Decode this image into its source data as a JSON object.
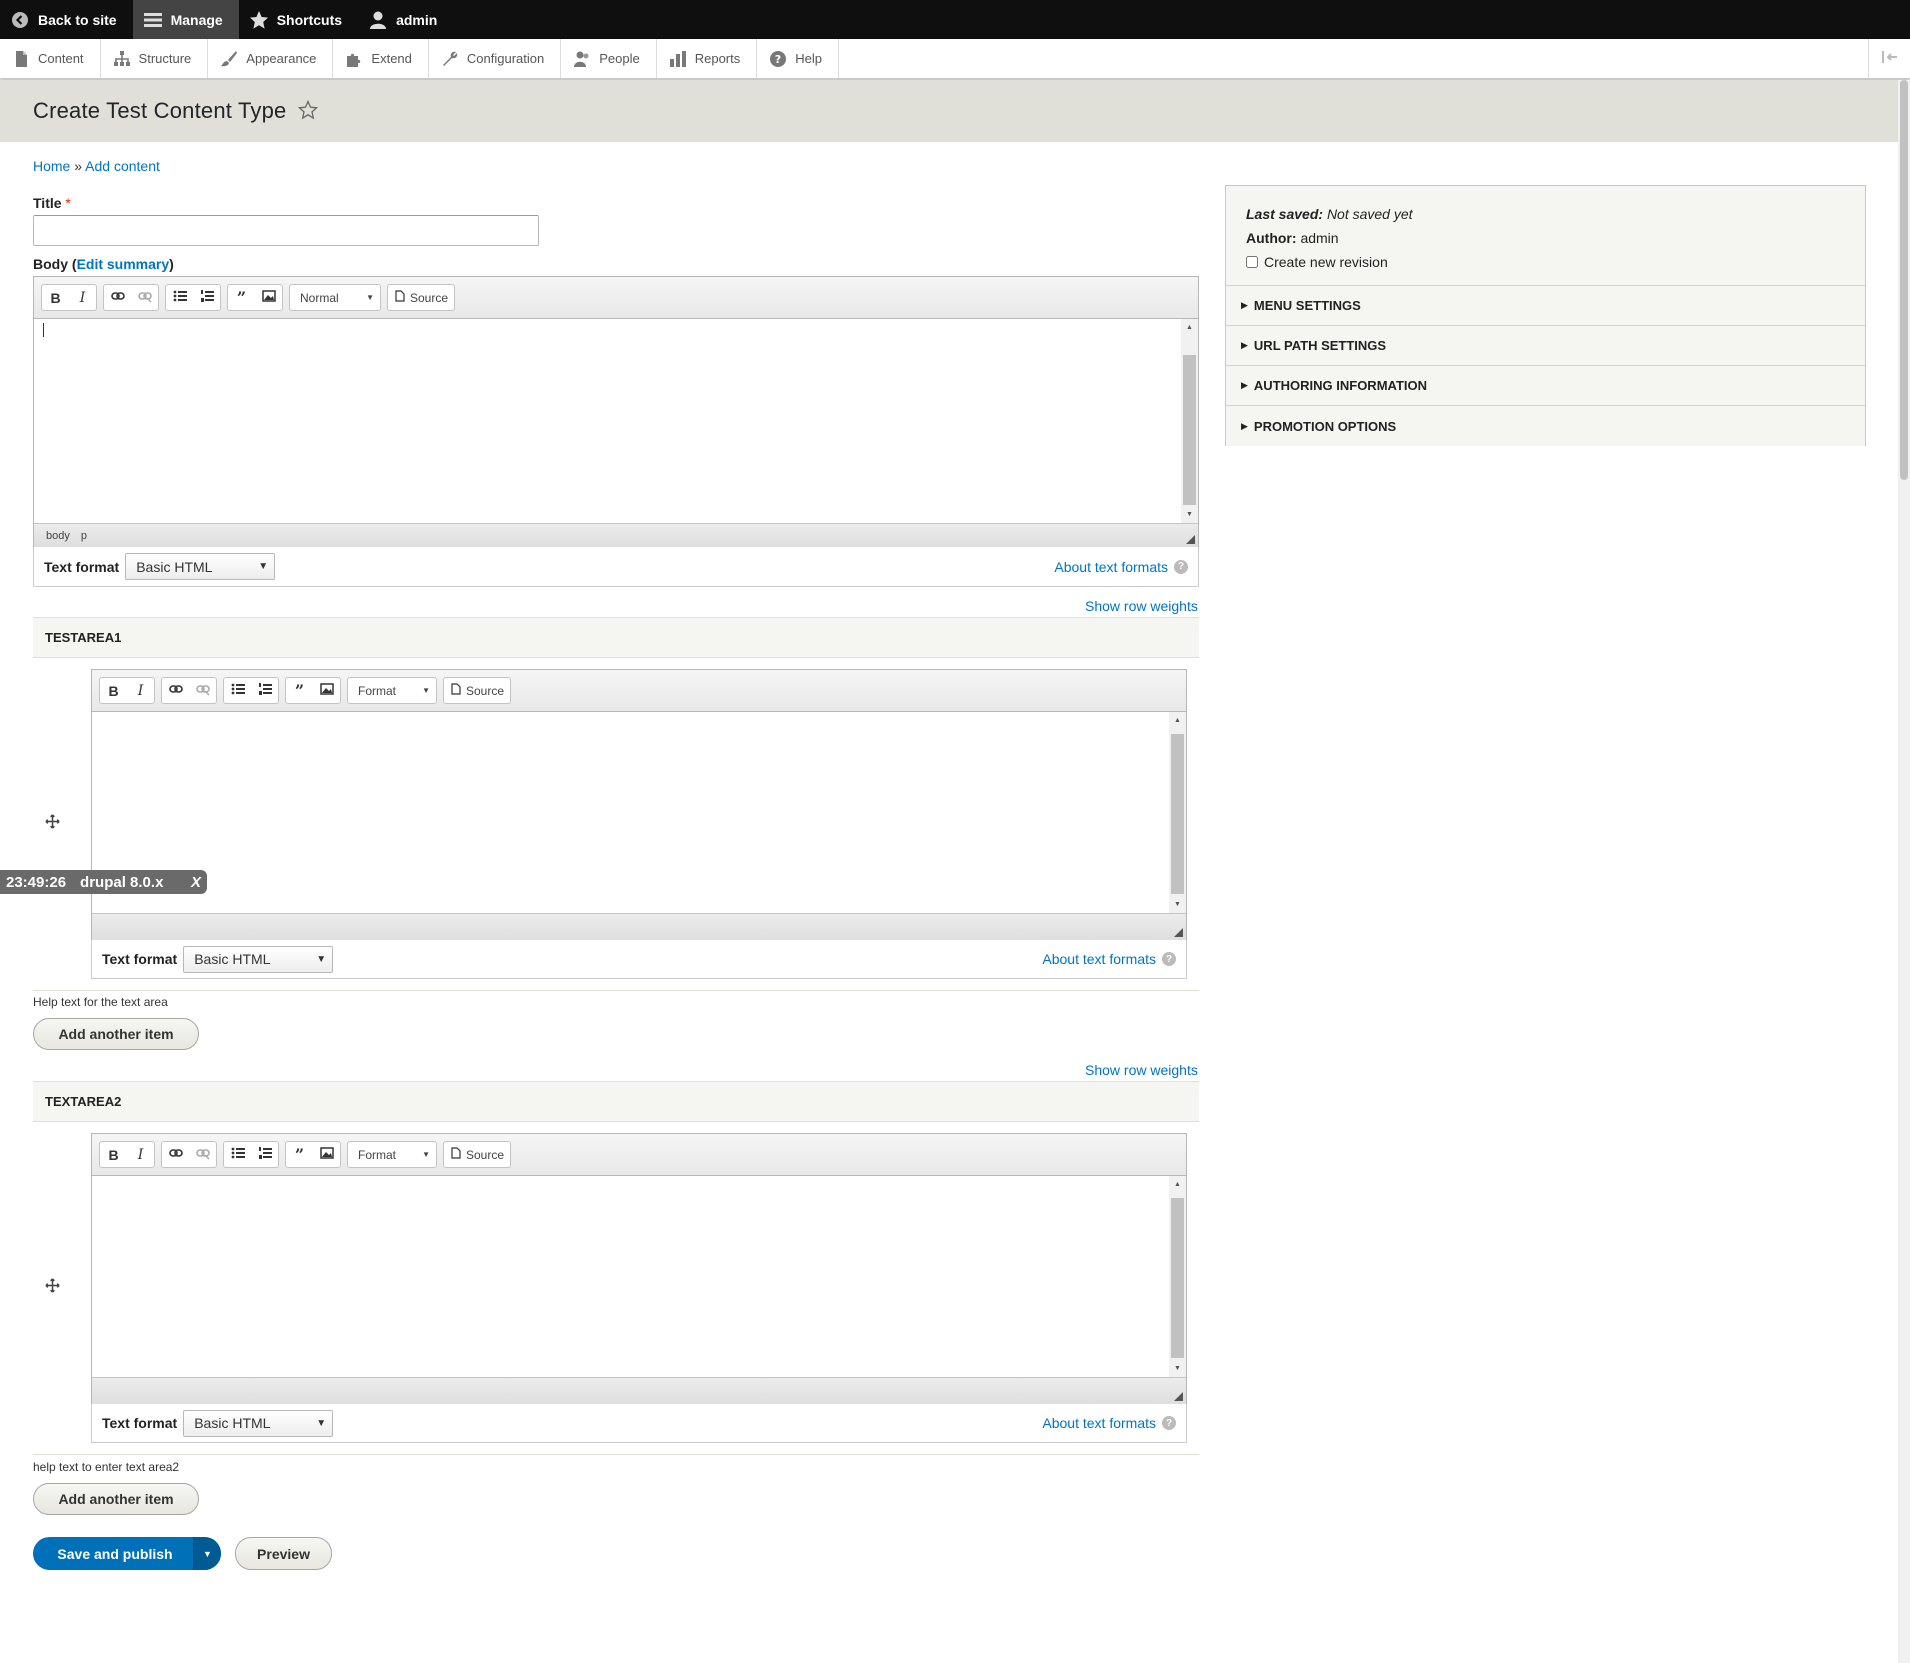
{
  "toolbar": {
    "back_to_site": "Back to site",
    "manage": "Manage",
    "shortcuts": "Shortcuts",
    "user": "admin"
  },
  "tray": {
    "items": [
      "Content",
      "Structure",
      "Appearance",
      "Extend",
      "Configuration",
      "People",
      "Reports",
      "Help"
    ]
  },
  "page": {
    "title": "Create Test Content Type"
  },
  "breadcrumb": {
    "home": "Home",
    "separator": "»",
    "add_content": "Add content"
  },
  "form": {
    "title_label": "Title",
    "required_mark": "*",
    "title_value": "",
    "body_label": "Body",
    "body_paren_open": "(",
    "edit_summary": "Edit summary",
    "body_paren_close": ")",
    "body_editor": {
      "format_dropdown": "Normal",
      "source_label": "Source",
      "path": [
        "body",
        "p"
      ]
    },
    "text_format_label": "Text format",
    "text_format_value": "Basic HTML",
    "about_text_formats": "About text formats",
    "help_icon": "?",
    "show_row_weights": "Show row weights",
    "add_another_item": "Add another item"
  },
  "fields": [
    {
      "name": "TESTAREA1",
      "format_dropdown": "Format",
      "source_label": "Source",
      "help_text": "Help text for the text area"
    },
    {
      "name": "TEXTAREA2",
      "format_dropdown": "Format",
      "source_label": "Source",
      "help_text": "help text to enter text area2"
    }
  ],
  "actions": {
    "save_and_publish": "Save and publish",
    "preview": "Preview"
  },
  "sidebar": {
    "last_saved_label": "Last saved:",
    "last_saved_value": "Not saved yet",
    "author_label": "Author:",
    "author_value": "admin",
    "create_new_revision": "Create new revision",
    "details": [
      "MENU SETTINGS",
      "URL PATH SETTINGS",
      "AUTHORING INFORMATION",
      "PROMOTION OPTIONS"
    ]
  },
  "timer": {
    "time": "23:49:26",
    "label": "drupal 8.0.x",
    "close": "X"
  },
  "icons": {
    "back": "chevron-left-circle-icon",
    "manage": "hamburger-icon",
    "shortcuts": "star-icon",
    "user": "person-icon",
    "drag": "move-arrows-icon"
  },
  "colors": {
    "link": "#0074bd",
    "primary_button": "#0071b8",
    "toolbar": "#0f0f0f",
    "page_head": "#e0e0d8"
  }
}
